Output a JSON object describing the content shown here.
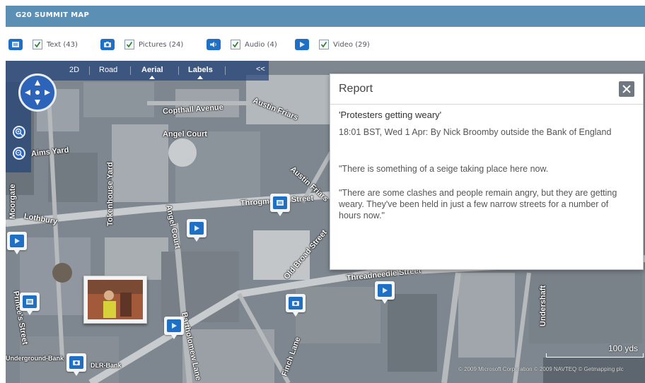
{
  "header": {
    "title": "G20 SUMMIT MAP"
  },
  "filters": [
    {
      "icon": "text-icon",
      "label": "Text (43)"
    },
    {
      "icon": "camera-icon",
      "label": "Pictures (24)"
    },
    {
      "icon": "speaker-icon",
      "label": "Audio (4)"
    },
    {
      "icon": "play-icon",
      "label": "Video (29)"
    }
  ],
  "map_toolbar": {
    "view_2d": "2D",
    "road": "Road",
    "aerial": "Aerial",
    "labels": "Labels",
    "collapse": "<<"
  },
  "report": {
    "title": "Report",
    "headline": "'Protesters getting weary'",
    "byline": "18:01 BST, Wed 1 Apr: By Nick Broomby outside the Bank of England",
    "quote1": "\"There is something of a seige taking place here now.",
    "quote2": "\"There are some clashes and people remain angry, but they are getting weary. They've been held in just a few narrow streets for a number of hours now.\""
  },
  "streets": [
    "Austin Friars",
    "Copthall Avenue",
    "Angel Court",
    "Aims Yard",
    "Tokenhouse Yard",
    "Angel Court",
    "Austin Friars",
    "Moorgate",
    "Lothbury",
    "Throgmorton Street",
    "Old Broad Street",
    "Bartholomew Lane",
    "Threadneedle Street",
    "Undershaft",
    "Prince's Street",
    "Finch Lane",
    "Underground-Bank",
    "DLR-Bank"
  ],
  "scale": {
    "label": "100 yds"
  },
  "copyright": "© 2009 Microsoft Corporation  © 2009 NAVTEQ  © Getmapping plc"
}
